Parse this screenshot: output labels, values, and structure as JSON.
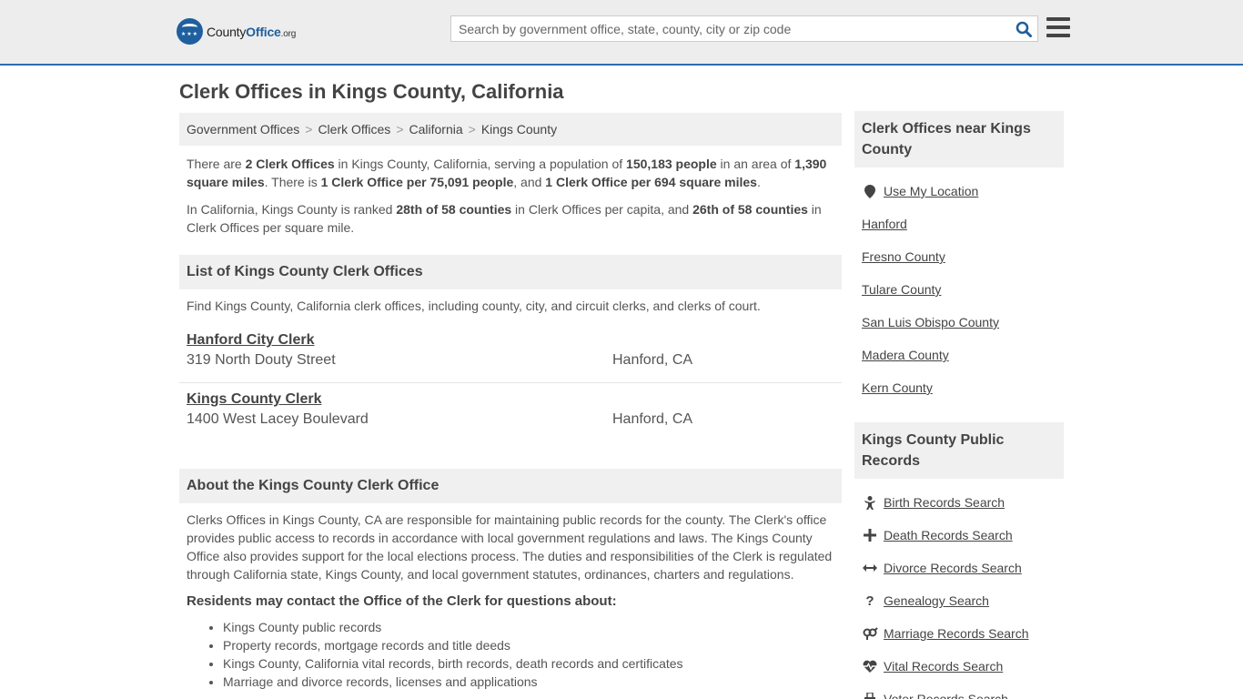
{
  "header": {
    "logo_county": "County",
    "logo_office": "Office",
    "logo_org": ".org",
    "search_placeholder": "Search by government office, state, county, city or zip code"
  },
  "page_title": "Clerk Offices in Kings County, California",
  "breadcrumb": [
    "Government Offices",
    "Clerk Offices",
    "California",
    "Kings County"
  ],
  "intro": {
    "p1": [
      "There are ",
      "2 Clerk Offices",
      " in Kings County, California, serving a population of ",
      "150,183 people",
      " in an area of ",
      "1,390 square miles",
      ". There is ",
      "1 Clerk Office per 75,091 people",
      ", and ",
      "1 Clerk Office per 694 square miles",
      "."
    ],
    "p2": [
      "In California, Kings County is ranked ",
      "28th of 58 counties",
      " in Clerk Offices per capita, and ",
      "26th of 58 counties",
      " in Clerk Offices per square mile."
    ]
  },
  "list_section": {
    "title": "List of Kings County Clerk Offices",
    "desc": "Find Kings County, California clerk offices, including county, city, and circuit clerks, and clerks of court.",
    "offices": [
      {
        "name": "Hanford City Clerk",
        "address": "319 North Douty Street",
        "city": "Hanford, CA"
      },
      {
        "name": "Kings County Clerk",
        "address": "1400 West Lacey Boulevard",
        "city": "Hanford, CA"
      }
    ]
  },
  "about_section": {
    "title": "About the Kings County Clerk Office",
    "text": "Clerks Offices in Kings County, CA are responsible for maintaining public records for the county. The Clerk's office provides public access to records in accordance with local government regulations and laws. The Kings County Office also provides support for the local elections process. The duties and responsibilities of the Clerk is regulated through California state, Kings County, and local government statutes, ordinances, charters and regulations.",
    "residents_heading": "Residents may contact the Office of the Clerk for questions about:",
    "bullets": [
      "Kings County public records",
      "Property records, mortgage records and title deeds",
      "Kings County, California vital records, birth records, death records and certificates",
      "Marriage and divorce records, licenses and applications"
    ]
  },
  "sidebar": {
    "near_title": "Clerk Offices near Kings County",
    "near_items": [
      {
        "label": "Use My Location",
        "icon": "map-pin-icon"
      },
      {
        "label": "Hanford"
      },
      {
        "label": "Fresno County"
      },
      {
        "label": "Tulare County"
      },
      {
        "label": "San Luis Obispo County"
      },
      {
        "label": "Madera County"
      },
      {
        "label": "Kern County"
      }
    ],
    "records_title": "Kings County Public Records",
    "records_items": [
      {
        "label": "Birth Records Search",
        "icon": "baby-icon"
      },
      {
        "label": "Death Records Search",
        "icon": "cross-icon"
      },
      {
        "label": "Divorce Records Search",
        "icon": "split-arrows-icon"
      },
      {
        "label": "Genealogy Search",
        "icon": "question-icon"
      },
      {
        "label": "Marriage Records Search",
        "icon": "gender-rings-icon"
      },
      {
        "label": "Vital Records Search",
        "icon": "heartbeat-icon"
      },
      {
        "label": "Voter Records Search",
        "icon": "ballot-icon"
      }
    ]
  }
}
